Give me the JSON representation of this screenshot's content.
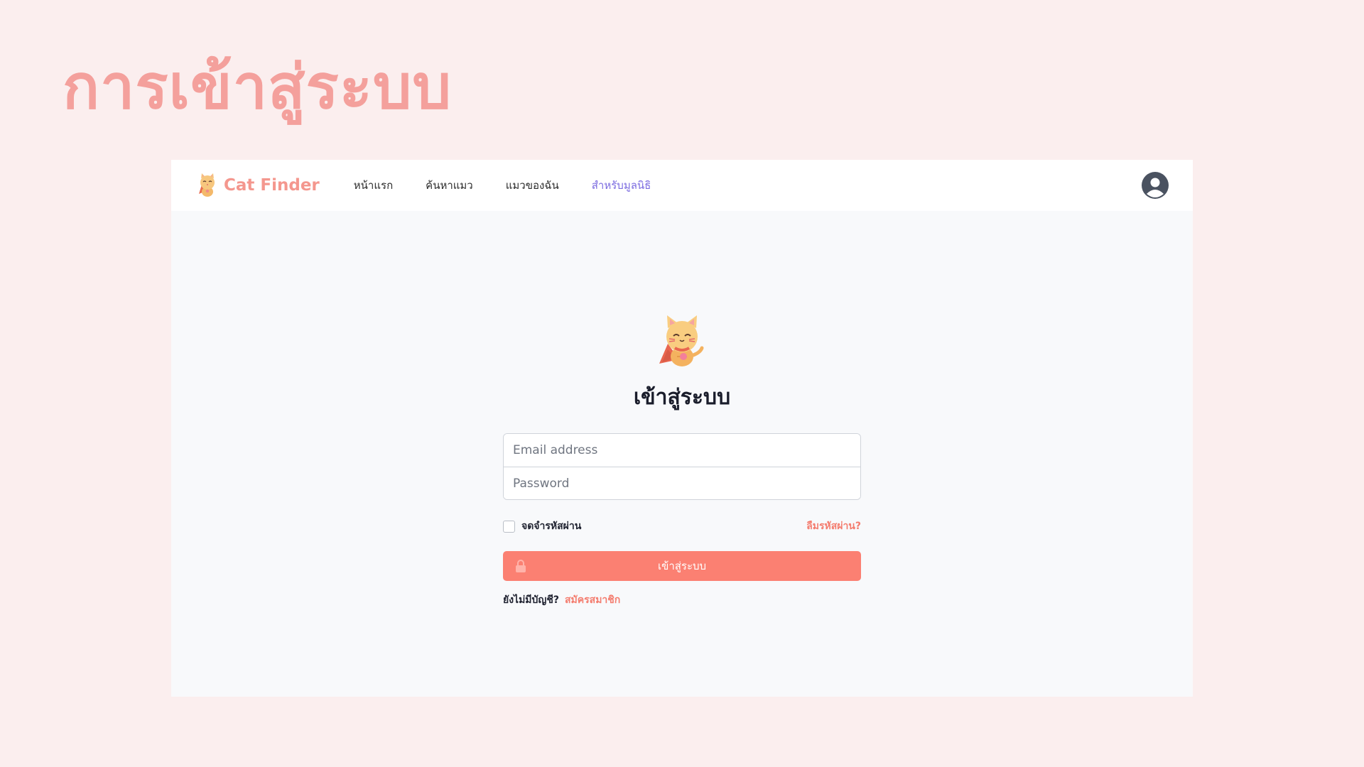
{
  "slide": {
    "title": "การเข้าสู่ระบบ"
  },
  "navbar": {
    "brand": "Cat Finder",
    "links": [
      {
        "label": "หน้าแรก"
      },
      {
        "label": "ค้นหาแมว"
      },
      {
        "label": "แมวของฉัน"
      },
      {
        "label": "สำหรับมูลนิธิ",
        "active": true
      }
    ],
    "avatar_icon": "user-circle-icon"
  },
  "login": {
    "mascot_icon": "cat-mascot-icon",
    "heading": "เข้าสู่ระบบ",
    "email": {
      "placeholder": "Email address",
      "value": ""
    },
    "password": {
      "placeholder": "Password",
      "value": ""
    },
    "remember_label": "จดจำรหัสผ่าน",
    "remember_checked": false,
    "forgot_link": "ลืมรหัสผ่าน?",
    "submit_label": "เข้าสู่ระบบ",
    "submit_icon": "lock-icon",
    "signup_prompt": "ยังไม่มีบัญชี?",
    "signup_link": "สมัครสมาชิก"
  },
  "colors": {
    "page_background": "#fbeeee",
    "title": "#f4a09c",
    "brand": "#f4978e",
    "active_nav": "#7b6be0",
    "primary_button": "#fb8072",
    "link": "#f47c6e"
  }
}
